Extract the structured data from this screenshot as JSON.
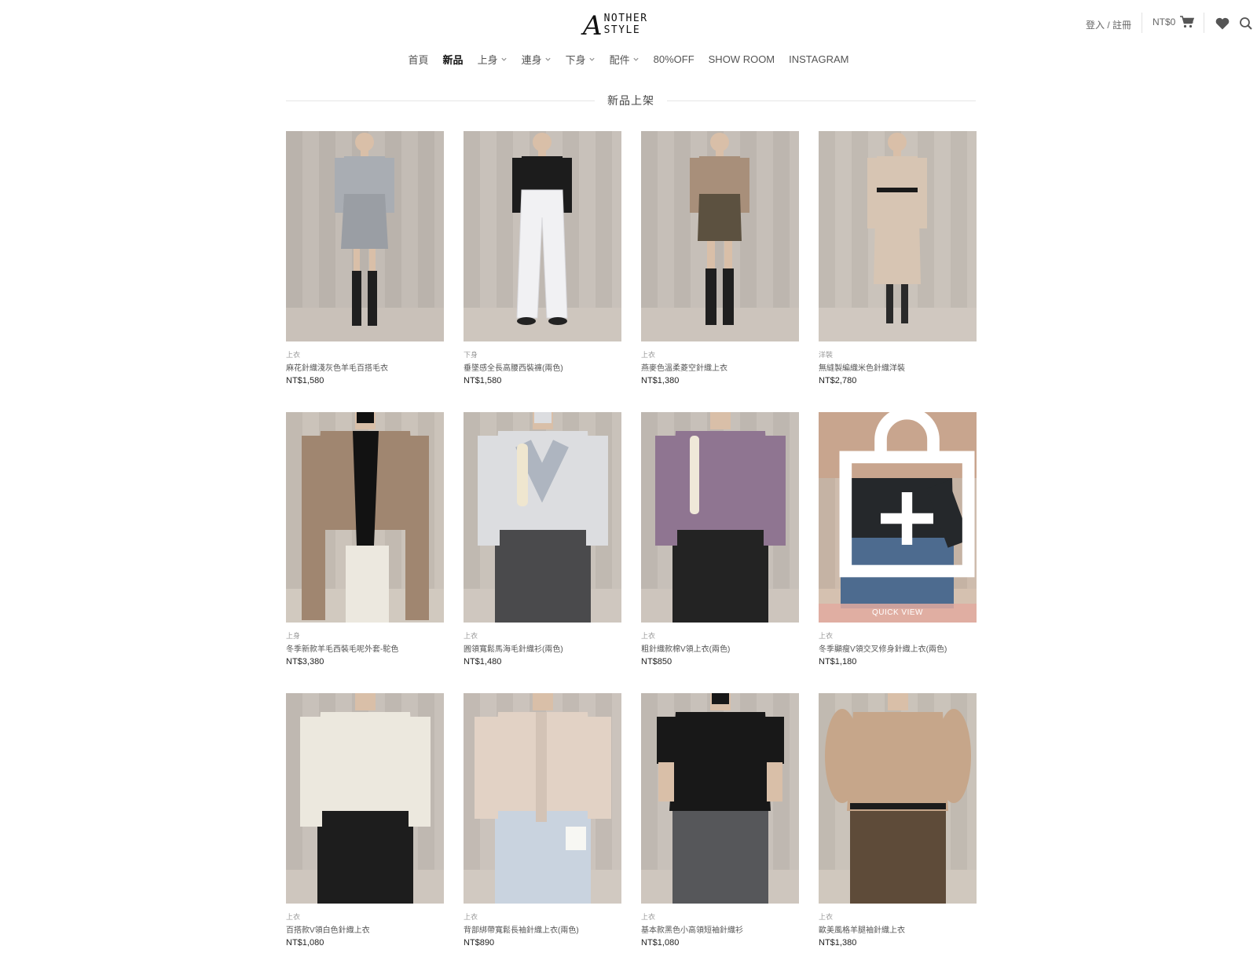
{
  "brand": {
    "mark": "A",
    "name": "NOTHER STYLE"
  },
  "utility": {
    "login": "登入 / 註冊",
    "cart_total": "NT$0",
    "cart_icon": "cart-icon",
    "wishlist_icon": "heart-icon",
    "search_icon": "search-icon"
  },
  "nav": [
    {
      "label": "首頁",
      "dropdown": false,
      "active": false
    },
    {
      "label": "新品",
      "dropdown": false,
      "active": true
    },
    {
      "label": "上身",
      "dropdown": true,
      "active": false
    },
    {
      "label": "連身",
      "dropdown": true,
      "active": false
    },
    {
      "label": "下身",
      "dropdown": true,
      "active": false
    },
    {
      "label": "配件",
      "dropdown": true,
      "active": false
    },
    {
      "label": "80%OFF",
      "dropdown": false,
      "active": false
    },
    {
      "label": "SHOW ROOM",
      "dropdown": false,
      "active": false
    },
    {
      "label": "INSTAGRAM",
      "dropdown": false,
      "active": false
    }
  ],
  "section_title": "新品上架",
  "quick_view": "QUICK VIEW",
  "products": [
    {
      "category": "上衣",
      "name": "麻花針織淺灰色羊毛百搭毛衣",
      "price": "NT$1,580",
      "colors": {
        "bg": "#bdb5ad",
        "top": "#a9adb3",
        "bottom": "#9a9ea4",
        "legs": "#1f1f1f",
        "skin": "#d9bfa8"
      },
      "style": "skirt"
    },
    {
      "category": "下身",
      "name": "垂墜感全長高腰西裝褲(兩色)",
      "price": "NT$1,580",
      "colors": {
        "bg": "#c2bab2",
        "top": "#1c1c1c",
        "bottom": "#f1f1f3",
        "legs": "#f1f1f3",
        "skin": "#d9bfa8"
      },
      "style": "pants"
    },
    {
      "category": "上衣",
      "name": "燕麥色溫柔菱空針織上衣",
      "price": "NT$1,380",
      "colors": {
        "bg": "#c0b8b0",
        "top": "#a88f7a",
        "bottom": "#5c5140",
        "legs": "#1f1f1f",
        "skin": "#d9bfa8"
      },
      "style": "shorts"
    },
    {
      "category": "洋裝",
      "name": "無縫製編織米色針織洋裝",
      "price": "NT$2,780",
      "colors": {
        "bg": "#c4bcb4",
        "top": "#d7c5b3",
        "bottom": "#d7c5b3",
        "legs": "#2a2a2a",
        "skin": "#d9bfa8"
      },
      "style": "dress"
    },
    {
      "category": "上身",
      "name": "冬季新款羊毛西裝毛呢外套-駝色",
      "price": "NT$3,380",
      "colors": {
        "bg": "#c5bdb3",
        "top": "#a08670",
        "bottom": "#ece8df",
        "legs": "#ece8df",
        "skin": "#d9bfa8"
      },
      "style": "coat"
    },
    {
      "category": "上衣",
      "name": "圓領寬鬆馬海毛針織衫(兩色)",
      "price": "NT$1,480",
      "colors": {
        "bg": "#c3bbb3",
        "top": "#dcdde0",
        "bottom": "#4a4a4c",
        "legs": "#4a4a4c",
        "skin": "#d9bfa8"
      },
      "style": "sheer"
    },
    {
      "category": "上衣",
      "name": "粗針織款棉V領上衣(兩色)",
      "price": "NT$850",
      "colors": {
        "bg": "#c1b9b1",
        "top": "#8f7591",
        "bottom": "#232323",
        "legs": "#232323",
        "skin": "#d9bfa8"
      },
      "style": "crop"
    },
    {
      "category": "上衣",
      "name": "冬季顯瘦V領交叉修身針織上衣(兩色)",
      "price": "NT$1,180",
      "colors": {
        "bg": "#c9b5a4",
        "top": "#25282b",
        "bottom": "#4d6b8f",
        "legs": "#4d6b8f",
        "skin": "#d9bfa8"
      },
      "style": "wrap",
      "hover": true
    },
    {
      "category": "上衣",
      "name": "百搭款V領白色針織上衣",
      "price": "NT$1,080",
      "colors": {
        "bg": "#c2bab2",
        "top": "#ece8de",
        "bottom": "#1d1d1d",
        "legs": "#1d1d1d",
        "skin": "#d9bfa8"
      },
      "style": "crop"
    },
    {
      "category": "上衣",
      "name": "背部綁帶寬鬆長袖針織上衣(兩色)",
      "price": "NT$890",
      "colors": {
        "bg": "#c5bdb5",
        "top": "#e2d2c5",
        "bottom": "#c9d3df",
        "legs": "#c9d3df",
        "skin": "#d9bfa8"
      },
      "style": "back"
    },
    {
      "category": "上衣",
      "name": "基本款黑色小高領短袖針織衫",
      "price": "NT$1,080",
      "colors": {
        "bg": "#c2bab2",
        "top": "#181818",
        "bottom": "#56575a",
        "legs": "#56575a",
        "skin": "#d9bfa8"
      },
      "style": "tee"
    },
    {
      "category": "上衣",
      "name": "歐美風格羊腿袖針織上衣",
      "price": "NT$1,380",
      "colors": {
        "bg": "#c4bcb2",
        "top": "#c6a68a",
        "bottom": "#5e4b39",
        "legs": "#5e4b39",
        "skin": "#d9bfa8"
      },
      "style": "puff"
    }
  ]
}
